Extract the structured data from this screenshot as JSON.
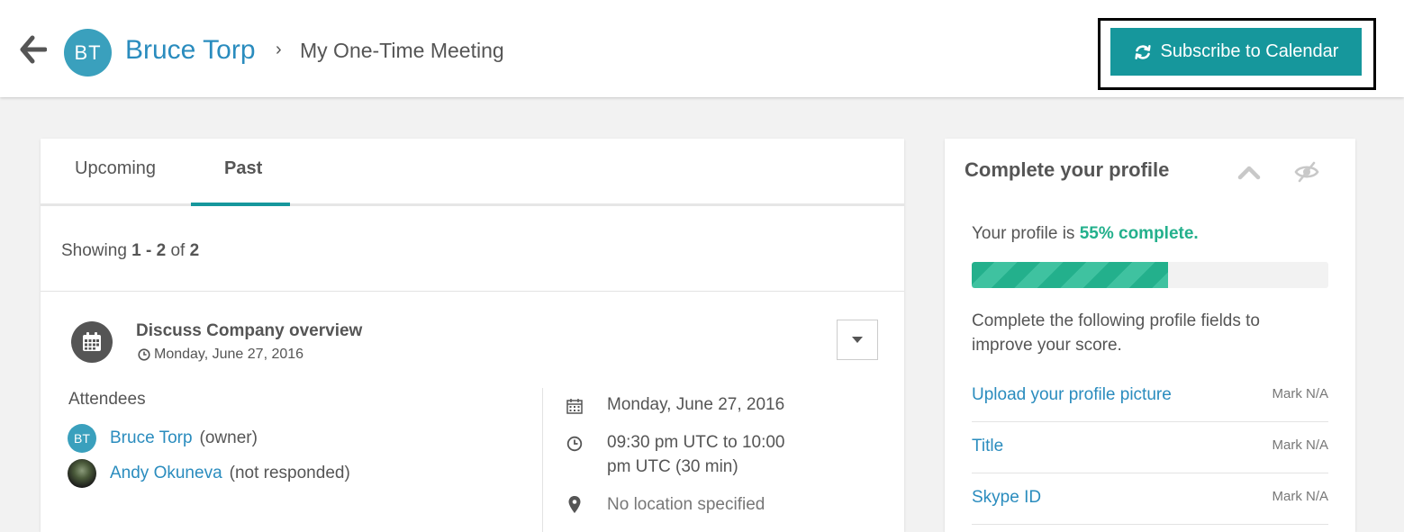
{
  "header": {
    "avatar_initials": "BT",
    "owner_name": "Bruce Torp",
    "breadcrumb_separator": "›",
    "page_title": "My One-Time Meeting",
    "subscribe_label": "Subscribe to Calendar"
  },
  "tabs": [
    {
      "label": "Upcoming",
      "active": false
    },
    {
      "label": "Past",
      "active": true
    }
  ],
  "showing": {
    "prefix": "Showing ",
    "range": "1 - 2",
    "of": " of ",
    "total": "2"
  },
  "event": {
    "title": "Discuss Company overview",
    "date_short": "Monday, June 27, 2016",
    "attendees_heading": "Attendees",
    "attendees": [
      {
        "initials": "BT",
        "name": "Bruce Torp",
        "status": "(owner)"
      },
      {
        "initials": "",
        "name": "Andy Okuneva",
        "status": "(not responded)"
      }
    ],
    "details": {
      "date": "Monday, June 27, 2016",
      "time": "09:30 pm UTC to 10:00 pm UTC (30 min)",
      "location": "No location specified"
    }
  },
  "profile": {
    "title": "Complete your profile",
    "status_prefix": "Your profile is ",
    "status_pct": "55% complete.",
    "progress": 0.55,
    "description": "Complete the following profile fields to improve your score.",
    "fields": [
      {
        "label": "Upload your profile picture",
        "mark": "Mark N/A"
      },
      {
        "label": "Title",
        "mark": "Mark N/A"
      },
      {
        "label": "Skype ID",
        "mark": "Mark N/A"
      }
    ]
  },
  "colors": {
    "accent": "#16979c",
    "link": "#2a8cbe",
    "progress": "#23b08c",
    "avatar": "#3aa0bd"
  },
  "icons": [
    "back-arrow-icon",
    "refresh-icon",
    "calendar-icon",
    "clock-icon",
    "caret-down-icon",
    "map-pin-icon",
    "chevron-up-icon",
    "eye-slash-icon"
  ]
}
